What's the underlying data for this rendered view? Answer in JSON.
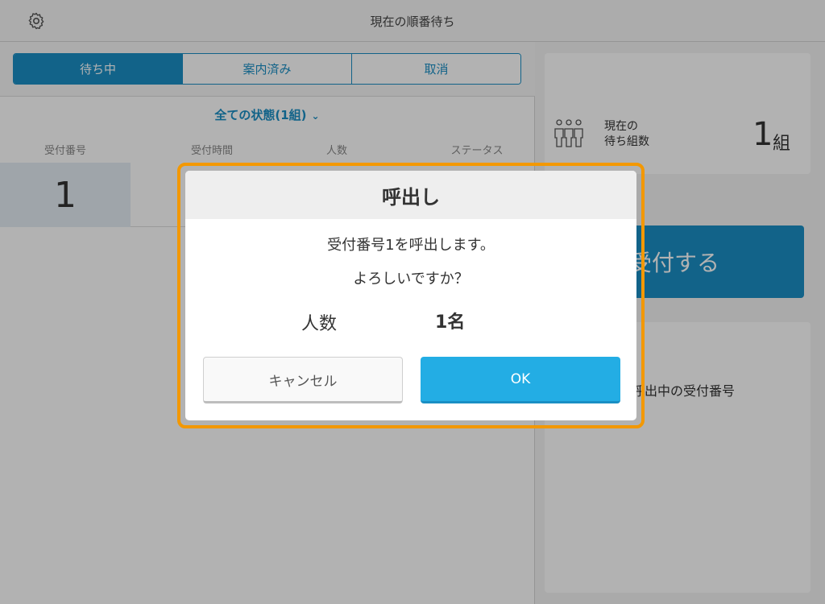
{
  "header": {
    "title": "現在の順番待ち",
    "settings_icon": "gear-icon"
  },
  "tabs": [
    {
      "label": "待ち中",
      "active": true
    },
    {
      "label": "案内済み",
      "active": false
    },
    {
      "label": "取消",
      "active": false
    }
  ],
  "filter": {
    "label": "全ての状態(1組)",
    "chevron": "⌄"
  },
  "table": {
    "columns": [
      "受付番号",
      "受付時間",
      "人数",
      "ステータス"
    ],
    "rows": [
      {
        "number": "1"
      }
    ]
  },
  "side": {
    "icon": "people-icon",
    "count_label": "現在の\n待ち組数",
    "count_value": "1",
    "count_unit": "組",
    "receive_button": "受付する",
    "calling_label": "呼出中の受付番号"
  },
  "dialog": {
    "title": "呼出し",
    "message": "受付番号1を呼出します。",
    "confirm": "よろしいですか？",
    "people_label": "人数",
    "people_value": "1名",
    "cancel_label": "キャンセル",
    "ok_label": "OK"
  },
  "colors": {
    "accent": "#1a8fc4",
    "ok": "#23ade4",
    "highlight": "#f39800"
  }
}
